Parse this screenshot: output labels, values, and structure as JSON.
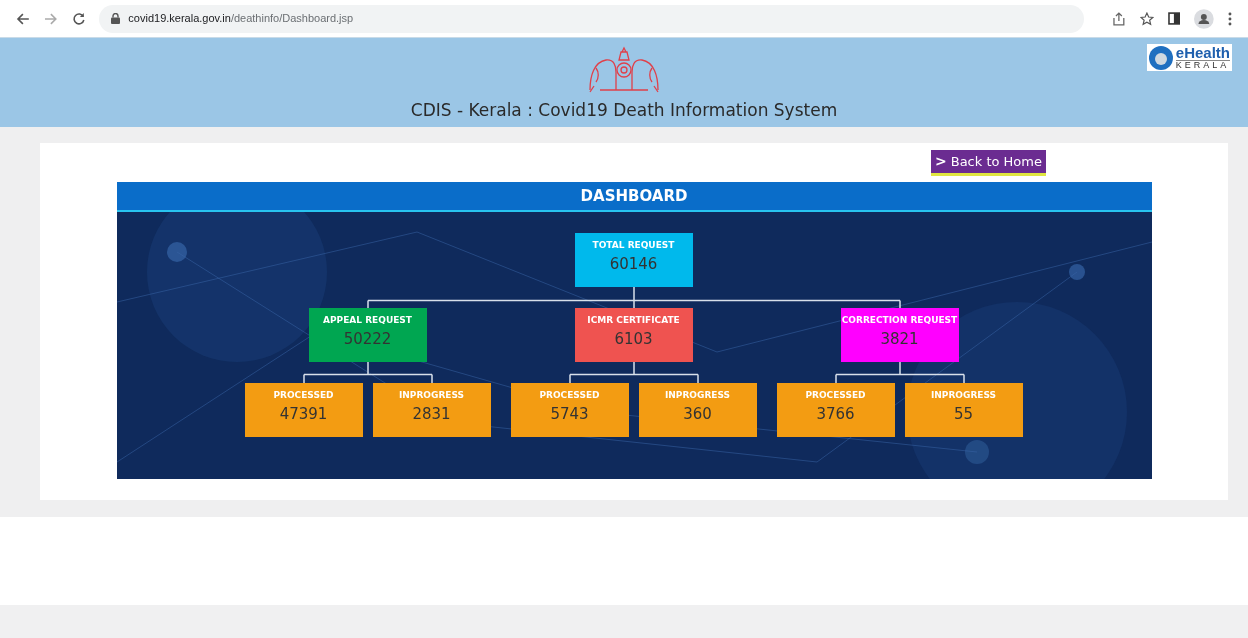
{
  "browser": {
    "url_host": "covid19.kerala.gov.in",
    "url_path": "/deathinfo/Dashboard.jsp"
  },
  "header": {
    "title": "CDIS - Kerala : Covid19 Death Information System",
    "logo": {
      "brand": "eHealth",
      "region": "KERALA"
    }
  },
  "back_button": {
    "label": "Back to Home",
    "icon": ">"
  },
  "dashboard": {
    "title": "DASHBOARD",
    "tree": {
      "label": "TOTAL REQUEST",
      "value": "60146",
      "color": "#00b9ec",
      "children": [
        {
          "label": "APPEAL REQUEST",
          "value": "50222",
          "color": "#00a651",
          "children": [
            {
              "label": "PROCESSED",
              "value": "47391",
              "color": "#f39c12"
            },
            {
              "label": "INPROGRESS",
              "value": "2831",
              "color": "#f39c12"
            }
          ]
        },
        {
          "label": "ICMR CERTIFICATE",
          "value": "6103",
          "color": "#ef5350",
          "children": [
            {
              "label": "PROCESSED",
              "value": "5743",
              "color": "#f39c12"
            },
            {
              "label": "INPROGRESS",
              "value": "360",
              "color": "#f39c12"
            }
          ]
        },
        {
          "label": "CORRECTION REQUEST",
          "value": "3821",
          "color": "#ff00ff",
          "children": [
            {
              "label": "PROCESSED",
              "value": "3766",
              "color": "#f39c12"
            },
            {
              "label": "INPROGRESS",
              "value": "55",
              "color": "#f39c12"
            }
          ]
        }
      ]
    }
  }
}
